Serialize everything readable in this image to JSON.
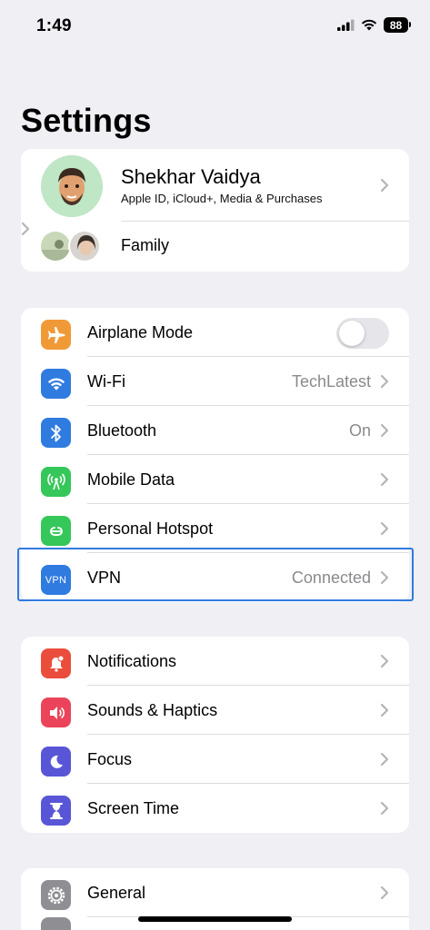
{
  "status_bar": {
    "time": "1:49",
    "battery": "88",
    "icons": [
      "cellular-signal-icon",
      "wifi-icon",
      "battery-icon"
    ]
  },
  "page": {
    "title": "Settings"
  },
  "profile": {
    "name": "Shekhar Vaidya",
    "subtitle": "Apple ID, iCloud+, Media & Purchases",
    "family_label": "Family"
  },
  "connectivity": {
    "airplane": {
      "label": "Airplane Mode",
      "on": false,
      "icon": "airplane-icon",
      "color": "#f09a37"
    },
    "wifi": {
      "label": "Wi-Fi",
      "value": "TechLatest",
      "icon": "wifi-icon",
      "color": "#2f7be0"
    },
    "bluetooth": {
      "label": "Bluetooth",
      "value": "On",
      "icon": "bluetooth-icon",
      "color": "#2f7be0"
    },
    "mobile_data": {
      "label": "Mobile Data",
      "icon": "antenna-icon",
      "color": "#35c759"
    },
    "hotspot": {
      "label": "Personal Hotspot",
      "icon": "hotspot-icon",
      "color": "#35c759"
    },
    "vpn": {
      "label": "VPN",
      "value": "Connected",
      "icon_text": "VPN",
      "color": "#2f7be0"
    }
  },
  "notifications_group": {
    "notifications": {
      "label": "Notifications",
      "icon": "bell-icon",
      "color": "#eb4d3d"
    },
    "sounds": {
      "label": "Sounds & Haptics",
      "icon": "speaker-icon",
      "color": "#eb445a"
    },
    "focus": {
      "label": "Focus",
      "icon": "moon-icon",
      "color": "#5856d6"
    },
    "screen_time": {
      "label": "Screen Time",
      "icon": "hourglass-icon",
      "color": "#5856d6"
    }
  },
  "general_group": {
    "general": {
      "label": "General",
      "icon": "gear-icon",
      "color": "#8e8e93"
    }
  },
  "colors": {
    "highlight": "#2f7be0",
    "background": "#efeff4"
  }
}
